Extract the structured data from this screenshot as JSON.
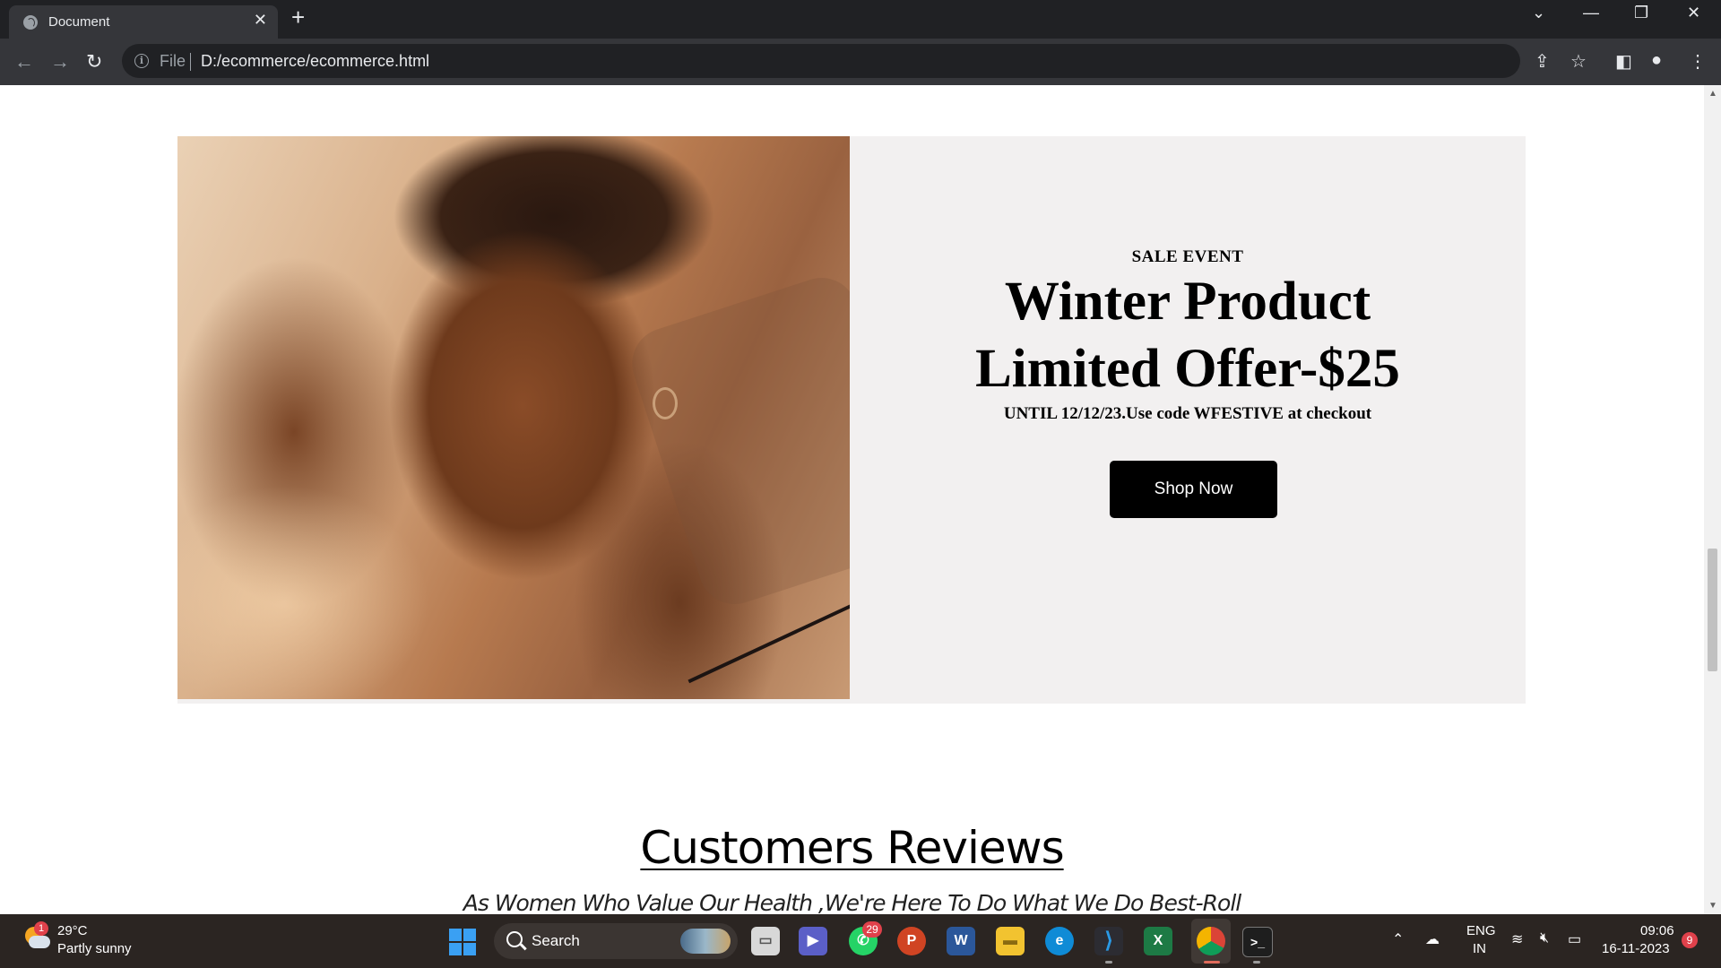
{
  "browser": {
    "tab_title": "Document",
    "tab_close": "✕",
    "new_tab": "+",
    "url_scheme": "File",
    "url": "D:/ecommerce/ecommerce.html",
    "window_controls": {
      "dropdown": "⌄",
      "minimize": "—",
      "restore": "❐",
      "close": "✕"
    },
    "nav": {
      "back": "←",
      "forward": "→",
      "reload": "↻"
    }
  },
  "banner": {
    "eyebrow": "SALE EVENT",
    "headline_line1": "Winter Product",
    "headline_line2": "Limited Offer-$25",
    "subtext": "UNTIL 12/12/23.Use code WFESTIVE at checkout",
    "button_label": "Shop Now",
    "image_description_icon": "model-portrait-image"
  },
  "reviews": {
    "title": "Customers Reviews",
    "subtitle": "As Women Who Value Our Health ,We're Here To Do What We Do Best-Roll"
  },
  "taskbar": {
    "weather_temp": "29°C",
    "weather_desc": "Partly sunny",
    "weather_badge": "1",
    "search_label": "Search",
    "whatsapp_badge": "29",
    "lang_line1": "ENG",
    "lang_line2": "IN",
    "time": "09:06",
    "date": "16-11-2023",
    "notification_count": "9"
  },
  "colors": {
    "banner_bg": "#f2f0f0",
    "button_bg": "#000000",
    "chrome_dark": "#202124",
    "chrome_toolbar": "#35363a",
    "taskbar_bg": "#2b2522"
  }
}
